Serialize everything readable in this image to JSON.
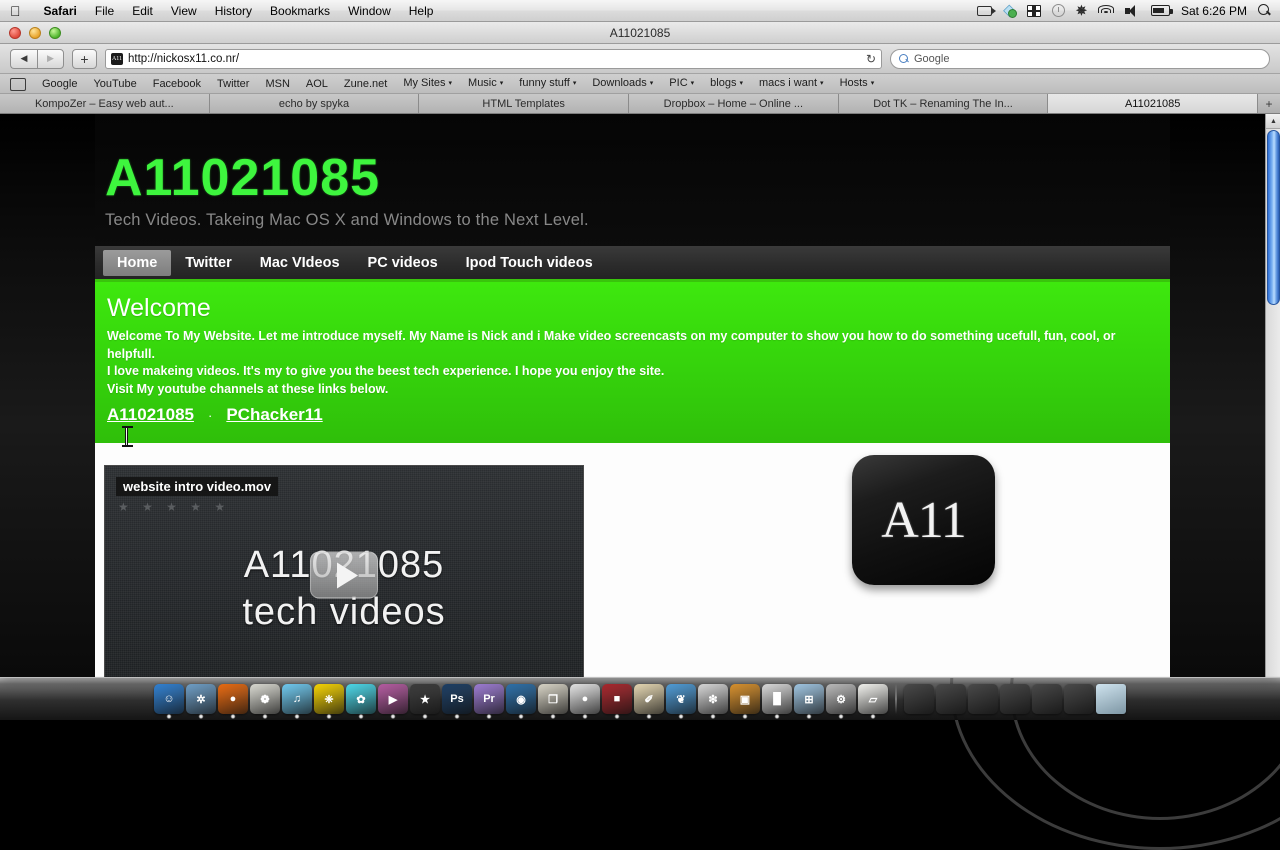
{
  "menubar": {
    "apple": "apple-logo",
    "items": [
      "Safari",
      "File",
      "Edit",
      "View",
      "History",
      "Bookmarks",
      "Window",
      "Help"
    ],
    "status_icons": [
      "video-camera-icon",
      "dropbox-icon",
      "ethernet-icon",
      "time-machine-icon",
      "bluetooth-icon",
      "wifi-icon",
      "volume-icon",
      "battery-icon"
    ],
    "clock": "Sat 6:26 PM",
    "spotlight": "search-icon"
  },
  "window": {
    "title": "A11021085"
  },
  "toolbar": {
    "back": "◀",
    "forward": "▶",
    "add": "+",
    "url": "http://nickosx11.co.nr/",
    "favicon_text": "A11",
    "reload": "↻",
    "search_placeholder": "Google",
    "search_value": "Google"
  },
  "bookmarks": [
    {
      "label": "Google",
      "dropdown": false
    },
    {
      "label": "YouTube",
      "dropdown": false
    },
    {
      "label": "Facebook",
      "dropdown": false
    },
    {
      "label": "Twitter",
      "dropdown": false
    },
    {
      "label": "MSN",
      "dropdown": false
    },
    {
      "label": "AOL",
      "dropdown": false
    },
    {
      "label": "Zune.net",
      "dropdown": false
    },
    {
      "label": "My Sites",
      "dropdown": true
    },
    {
      "label": "Music",
      "dropdown": true
    },
    {
      "label": "funny stuff",
      "dropdown": true
    },
    {
      "label": "Downloads",
      "dropdown": true
    },
    {
      "label": "PIC",
      "dropdown": true
    },
    {
      "label": "blogs",
      "dropdown": true
    },
    {
      "label": "macs i want",
      "dropdown": true
    },
    {
      "label": "Hosts",
      "dropdown": true
    }
  ],
  "tabs": [
    {
      "label": "KompoZer – Easy web aut...",
      "active": false
    },
    {
      "label": "echo by spyka",
      "active": false
    },
    {
      "label": "HTML Templates",
      "active": false
    },
    {
      "label": "Dropbox – Home – Online ...",
      "active": false
    },
    {
      "label": "Dot TK – Renaming The In...",
      "active": false
    },
    {
      "label": "A11021085",
      "active": true
    }
  ],
  "tab_add_label": "+",
  "site": {
    "title": "A11021085",
    "tagline": "Tech Videos. Takeing Mac OS X and Windows to the Next Level.",
    "nav": [
      {
        "label": "Home",
        "active": true
      },
      {
        "label": "Twitter",
        "active": false
      },
      {
        "label": "Mac VIdeos",
        "active": false
      },
      {
        "label": "PC videos",
        "active": false
      },
      {
        "label": "Ipod Touch videos",
        "active": false
      }
    ],
    "welcome": {
      "heading": "Welcome",
      "line1": "Welcome To My Website. Let me introduce myself. My Name is Nick and i Make video screencasts on my computer to show you how to do something ucefull, fun, cool, or helpfull.",
      "line2": "I love makeing videos. It's my to give you the beest tech experience. I hope you enjoy the site.",
      "line3": "Visit My youtube channels at these links below.",
      "link1": "A11021085",
      "separator": "·",
      "link2": "PChacker11"
    },
    "video": {
      "title": "website intro video.mov",
      "stars": "★ ★ ★ ★ ★",
      "text_line1": "A11021085",
      "text_line2": "tech videos",
      "play": "play-button"
    },
    "logo_text": "A11"
  },
  "colors": {
    "site_green_title": "#3ef53e",
    "welcome_green": "#36d60c",
    "nav_underline": "#39c40c",
    "page_dark": "#121212"
  },
  "dock": {
    "icons": [
      {
        "name": "finder",
        "color": "#2f7fd0",
        "glyph": "☺"
      },
      {
        "name": "safari",
        "color": "#6d9dc5",
        "glyph": "✲"
      },
      {
        "name": "firefox",
        "color": "#e8690f",
        "glyph": "●"
      },
      {
        "name": "iphoto",
        "color": "#d8d8d0",
        "glyph": "❁"
      },
      {
        "name": "itunes",
        "color": "#6ec8ee",
        "glyph": "♫"
      },
      {
        "name": "twitter",
        "color": "#f4d200",
        "glyph": "❈"
      },
      {
        "name": "adium",
        "color": "#4ad7e8",
        "glyph": "✿"
      },
      {
        "name": "imovie",
        "color": "#b45aa0",
        "glyph": "▶"
      },
      {
        "name": "istar",
        "color": "#3a3a3a",
        "glyph": "★"
      },
      {
        "name": "photoshop",
        "color": "#1b3d63",
        "glyph": "Ps"
      },
      {
        "name": "premiere",
        "color": "#9b7ad1",
        "glyph": "Pr"
      },
      {
        "name": "encore",
        "color": "#2c6fa8",
        "glyph": "◉"
      },
      {
        "name": "preview",
        "color": "#d6d2c4",
        "glyph": "❐"
      },
      {
        "name": "chrome",
        "color": "#e2e2e2",
        "glyph": "●"
      },
      {
        "name": "book",
        "color": "#a8262c",
        "glyph": "■"
      },
      {
        "name": "pages",
        "color": "#e3d5b0",
        "glyph": "✐"
      },
      {
        "name": "cyberduck",
        "color": "#4e9bd6",
        "glyph": "❦"
      },
      {
        "name": "compass",
        "color": "#d5d5d5",
        "glyph": "❇"
      },
      {
        "name": "keynote",
        "color": "#d68f2c",
        "glyph": "▣"
      },
      {
        "name": "numbers",
        "color": "#d8d8d8",
        "glyph": "█"
      },
      {
        "name": "spaces",
        "color": "#9ec4e0",
        "glyph": "⊞"
      },
      {
        "name": "system-preferences",
        "color": "#b9b9b9",
        "glyph": "⚙"
      },
      {
        "name": "documents",
        "color": "#f0f0ec",
        "glyph": "▱"
      }
    ],
    "trash": "trash-icon"
  }
}
